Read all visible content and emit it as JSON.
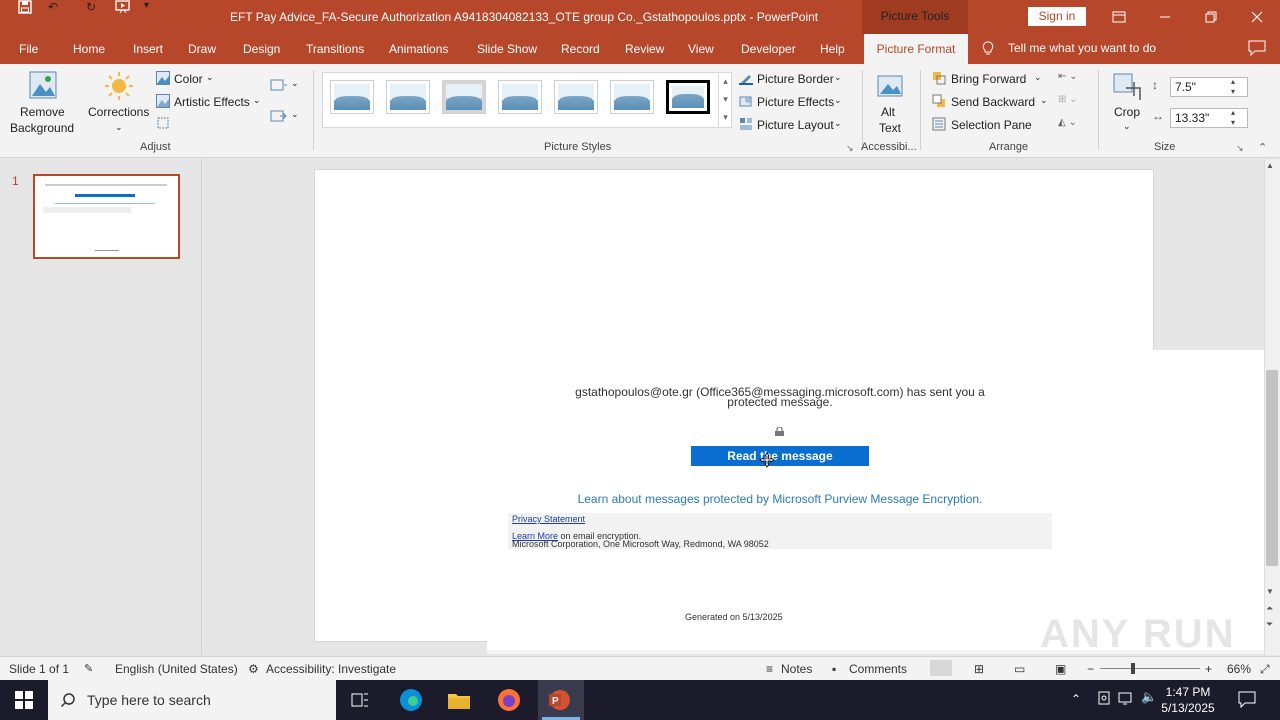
{
  "titlebar": {
    "title": "EFT Pay Advice_FA-Secure Authorization A9418304082133_OTE group Co._Gstathopoulos.pptx  -  PowerPoint",
    "context_tab": "Picture Tools",
    "sign_in": "Sign in"
  },
  "menu": {
    "tabs": [
      "File",
      "Home",
      "Insert",
      "Draw",
      "Design",
      "Transitions",
      "Animations",
      "Slide Show",
      "Record",
      "Review",
      "View",
      "Developer",
      "Help"
    ],
    "active_tab": "Picture Format",
    "tell_me": "Tell me what you want to do"
  },
  "ribbon": {
    "remove_background": [
      "Remove",
      "Background"
    ],
    "corrections": "Corrections",
    "color": "Color",
    "artistic_effects": "Artistic Effects",
    "group_adjust": "Adjust",
    "group_picture_styles": "Picture Styles",
    "picture_border": "Picture Border",
    "picture_effects": "Picture Effects",
    "picture_layout": "Picture Layout",
    "alt_text": [
      "Alt",
      "Text"
    ],
    "group_accessibility": "Accessibi...",
    "bring_forward": "Bring Forward",
    "send_backward": "Send Backward",
    "selection_pane": "Selection Pane",
    "group_arrange": "Arrange",
    "crop": "Crop",
    "height": "7.5\"",
    "width": "13.33\"",
    "group_size": "Size"
  },
  "slides_pane": {
    "slide_number": "1"
  },
  "slide": {
    "sender_line1": "gstathopoulos@ote.gr (Office365@messaging.microsoft.com) has sent you a",
    "sender_line2": "protected message.",
    "read_button": "Read the message",
    "learn_line": "Learn about messages protected by Microsoft Purview Message Encryption.",
    "privacy": "Privacy Statement",
    "learn_more": "Learn More",
    "learn_more_rest": " on email encryption.",
    "address": "Microsoft Corporation, One Microsoft Way, Redmond, WA 98052",
    "generated": "Generated on 5/13/2025"
  },
  "statusbar": {
    "slide_info": "Slide 1 of 1",
    "language": "English (United States)",
    "accessibility": "Accessibility: Investigate",
    "notes": "Notes",
    "comments": "Comments",
    "zoom": "66%"
  },
  "taskbar": {
    "search_placeholder": "Type here to search",
    "time": "1:47 PM",
    "date": "5/13/2025"
  },
  "watermark": "ANY RUN",
  "colors": {
    "accent": "#b7472a",
    "button_blue": "#0a6ed1",
    "link_blue": "#2a7ab8"
  }
}
